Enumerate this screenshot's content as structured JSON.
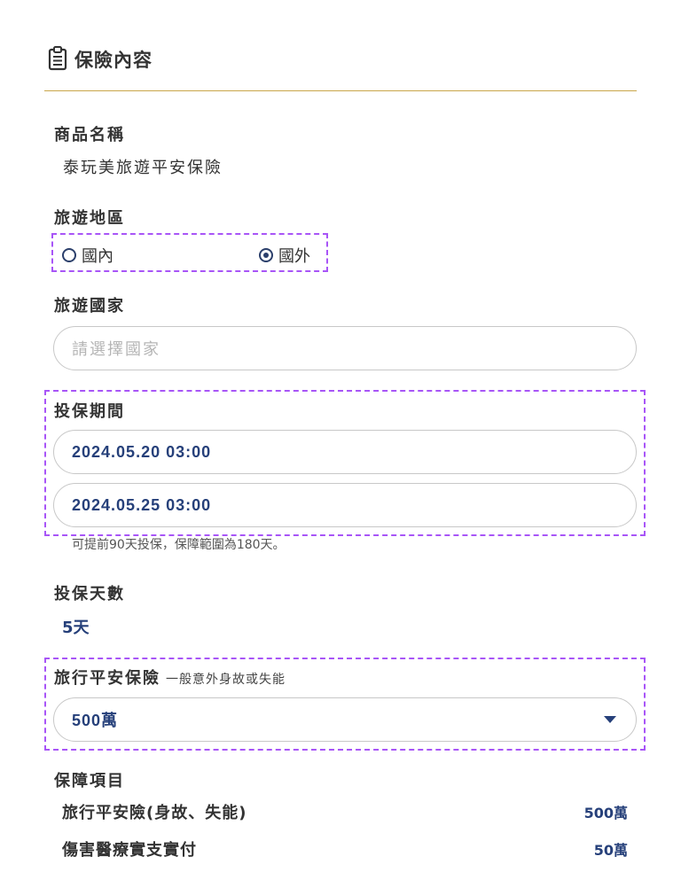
{
  "section": {
    "title": "保險內容",
    "icon": "clipboard-icon"
  },
  "product": {
    "label": "商品名稱",
    "value": "泰玩美旅遊平安保險"
  },
  "region": {
    "label": "旅遊地區",
    "options": [
      {
        "label": "國內",
        "checked": false
      },
      {
        "label": "國外",
        "checked": true
      }
    ]
  },
  "country": {
    "label": "旅遊國家",
    "placeholder": "請選擇國家"
  },
  "period": {
    "label": "投保期間",
    "start": "2024.05.20 03:00",
    "end": "2024.05.25 03:00",
    "note": "可提前90天投保，保障範圍為180天。"
  },
  "days": {
    "label": "投保天數",
    "value": "5天"
  },
  "travel_insurance": {
    "label": "旅行平安保險",
    "sublabel": "一般意外身故或失能",
    "selected": "500萬"
  },
  "coverage": {
    "label": "保障項目",
    "items": [
      {
        "name": "旅行平安險(身故、失能)",
        "amount": "500萬"
      },
      {
        "name": "傷害醫療實支實付",
        "amount": "50萬"
      }
    ]
  },
  "colors": {
    "accent": "#26407a",
    "divider": "#c9a64a",
    "highlight": "#a855f7"
  }
}
